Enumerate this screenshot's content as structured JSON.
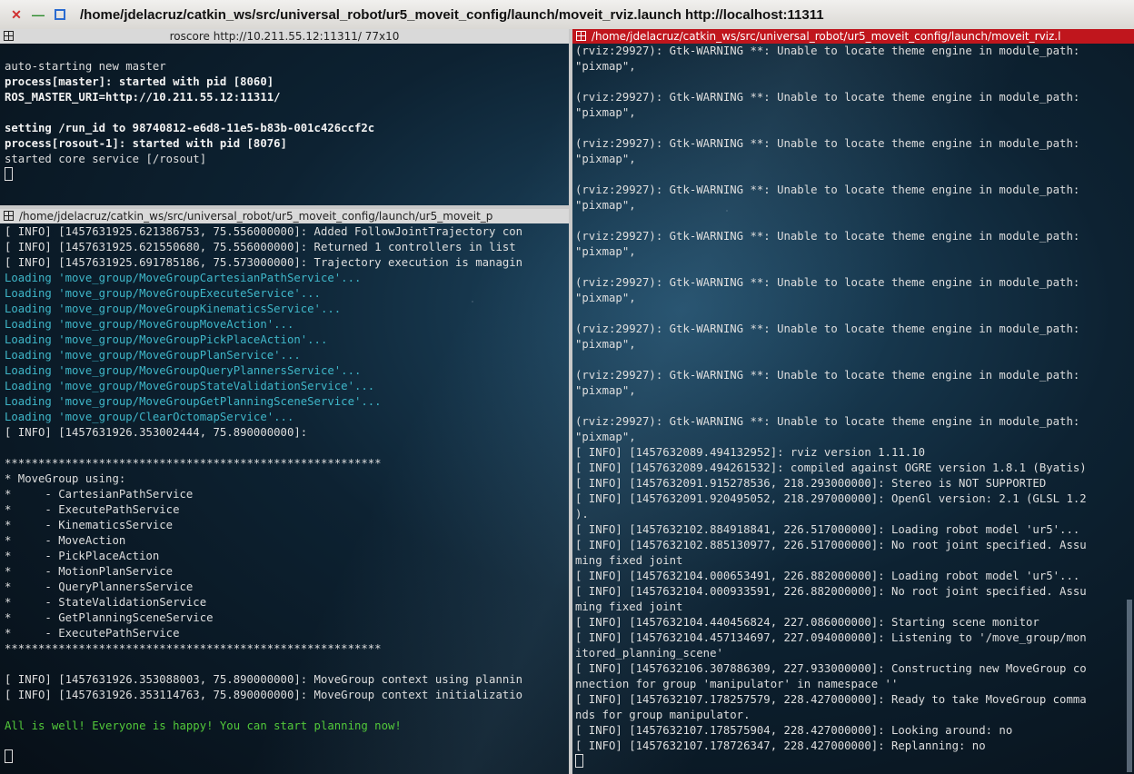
{
  "window": {
    "title": "/home/jdelacruz/catkin_ws/src/universal_robot/ur5_moveit_config/launch/moveit_rviz.launch http://localhost:11311"
  },
  "pane_roscore": {
    "title": "roscore http://10.211.55.12:11311/ 77x10",
    "lines": [
      {
        "t": "",
        "s": ""
      },
      {
        "t": "auto-starting new master",
        "s": ""
      },
      {
        "t": "process[master]: started with pid [8060]",
        "s": "b"
      },
      {
        "t": "ROS_MASTER_URI=http://10.211.55.12:11311/",
        "s": "b"
      },
      {
        "t": "",
        "s": ""
      },
      {
        "t": "setting /run_id to 98740812-e6d8-11e5-b83b-001c426ccf2c",
        "s": "b"
      },
      {
        "t": "process[rosout-1]: started with pid [8076]",
        "s": "b"
      },
      {
        "t": "started core service [/rosout]",
        "s": ""
      }
    ]
  },
  "pane_movegroup": {
    "title": "/home/jdelacruz/catkin_ws/src/universal_robot/ur5_moveit_config/launch/ur5_moveit_p",
    "lines": [
      {
        "t": "[ INFO] [1457631925.621386753, 75.556000000]: Added FollowJointTrajectory con",
        "s": ""
      },
      {
        "t": "[ INFO] [1457631925.621550680, 75.556000000]: Returned 1 controllers in list",
        "s": ""
      },
      {
        "t": "[ INFO] [1457631925.691785186, 75.573000000]: Trajectory execution is managin",
        "s": ""
      },
      {
        "t": "Loading 'move_group/MoveGroupCartesianPathService'...",
        "s": "c"
      },
      {
        "t": "Loading 'move_group/MoveGroupExecuteService'...",
        "s": "c"
      },
      {
        "t": "Loading 'move_group/MoveGroupKinematicsService'...",
        "s": "c"
      },
      {
        "t": "Loading 'move_group/MoveGroupMoveAction'...",
        "s": "c"
      },
      {
        "t": "Loading 'move_group/MoveGroupPickPlaceAction'...",
        "s": "c"
      },
      {
        "t": "Loading 'move_group/MoveGroupPlanService'...",
        "s": "c"
      },
      {
        "t": "Loading 'move_group/MoveGroupQueryPlannersService'...",
        "s": "c"
      },
      {
        "t": "Loading 'move_group/MoveGroupStateValidationService'...",
        "s": "c"
      },
      {
        "t": "Loading 'move_group/MoveGroupGetPlanningSceneService'...",
        "s": "c"
      },
      {
        "t": "Loading 'move_group/ClearOctomapService'...",
        "s": "c"
      },
      {
        "t": "[ INFO] [1457631926.353002444, 75.890000000]:",
        "s": ""
      },
      {
        "t": "",
        "s": ""
      },
      {
        "t": "********************************************************",
        "s": ""
      },
      {
        "t": "* MoveGroup using:",
        "s": ""
      },
      {
        "t": "*     - CartesianPathService",
        "s": ""
      },
      {
        "t": "*     - ExecutePathService",
        "s": ""
      },
      {
        "t": "*     - KinematicsService",
        "s": ""
      },
      {
        "t": "*     - MoveAction",
        "s": ""
      },
      {
        "t": "*     - PickPlaceAction",
        "s": ""
      },
      {
        "t": "*     - MotionPlanService",
        "s": ""
      },
      {
        "t": "*     - QueryPlannersService",
        "s": ""
      },
      {
        "t": "*     - StateValidationService",
        "s": ""
      },
      {
        "t": "*     - GetPlanningSceneService",
        "s": ""
      },
      {
        "t": "*     - ExecutePathService",
        "s": ""
      },
      {
        "t": "********************************************************",
        "s": ""
      },
      {
        "t": "",
        "s": ""
      },
      {
        "t": "[ INFO] [1457631926.353088003, 75.890000000]: MoveGroup context using plannin",
        "s": ""
      },
      {
        "t": "[ INFO] [1457631926.353114763, 75.890000000]: MoveGroup context initializatio",
        "s": ""
      },
      {
        "t": "",
        "s": ""
      },
      {
        "t": "All is well! Everyone is happy! You can start planning now!",
        "s": "g"
      }
    ]
  },
  "pane_rviz": {
    "title": "/home/jdelacruz/catkin_ws/src/universal_robot/ur5_moveit_config/launch/moveit_rviz.l",
    "lines": [
      {
        "t": "(rviz:29927): Gtk-WARNING **: Unable to locate theme engine in module_path:",
        "s": ""
      },
      {
        "t": "\"pixmap\",",
        "s": ""
      },
      {
        "t": "",
        "s": ""
      },
      {
        "t": "(rviz:29927): Gtk-WARNING **: Unable to locate theme engine in module_path:",
        "s": ""
      },
      {
        "t": "\"pixmap\",",
        "s": ""
      },
      {
        "t": "",
        "s": ""
      },
      {
        "t": "(rviz:29927): Gtk-WARNING **: Unable to locate theme engine in module_path:",
        "s": ""
      },
      {
        "t": "\"pixmap\",",
        "s": ""
      },
      {
        "t": "",
        "s": ""
      },
      {
        "t": "(rviz:29927): Gtk-WARNING **: Unable to locate theme engine in module_path:",
        "s": ""
      },
      {
        "t": "\"pixmap\",",
        "s": ""
      },
      {
        "t": "",
        "s": ""
      },
      {
        "t": "(rviz:29927): Gtk-WARNING **: Unable to locate theme engine in module_path:",
        "s": ""
      },
      {
        "t": "\"pixmap\",",
        "s": ""
      },
      {
        "t": "",
        "s": ""
      },
      {
        "t": "(rviz:29927): Gtk-WARNING **: Unable to locate theme engine in module_path:",
        "s": ""
      },
      {
        "t": "\"pixmap\",",
        "s": ""
      },
      {
        "t": "",
        "s": ""
      },
      {
        "t": "(rviz:29927): Gtk-WARNING **: Unable to locate theme engine in module_path:",
        "s": ""
      },
      {
        "t": "\"pixmap\",",
        "s": ""
      },
      {
        "t": "",
        "s": ""
      },
      {
        "t": "(rviz:29927): Gtk-WARNING **: Unable to locate theme engine in module_path:",
        "s": ""
      },
      {
        "t": "\"pixmap\",",
        "s": ""
      },
      {
        "t": "",
        "s": ""
      },
      {
        "t": "(rviz:29927): Gtk-WARNING **: Unable to locate theme engine in module_path:",
        "s": ""
      },
      {
        "t": "\"pixmap\",",
        "s": ""
      },
      {
        "t": "[ INFO] [1457632089.494132952]: rviz version 1.11.10",
        "s": ""
      },
      {
        "t": "[ INFO] [1457632089.494261532]: compiled against OGRE version 1.8.1 (Byatis)",
        "s": ""
      },
      {
        "t": "[ INFO] [1457632091.915278536, 218.293000000]: Stereo is NOT SUPPORTED",
        "s": ""
      },
      {
        "t": "[ INFO] [1457632091.920495052, 218.297000000]: OpenGl version: 2.1 (GLSL 1.2",
        "s": ""
      },
      {
        "t": ").",
        "s": ""
      },
      {
        "t": "[ INFO] [1457632102.884918841, 226.517000000]: Loading robot model 'ur5'...",
        "s": ""
      },
      {
        "t": "[ INFO] [1457632102.885130977, 226.517000000]: No root joint specified. Assu",
        "s": ""
      },
      {
        "t": "ming fixed joint",
        "s": ""
      },
      {
        "t": "[ INFO] [1457632104.000653491, 226.882000000]: Loading robot model 'ur5'...",
        "s": ""
      },
      {
        "t": "[ INFO] [1457632104.000933591, 226.882000000]: No root joint specified. Assu",
        "s": ""
      },
      {
        "t": "ming fixed joint",
        "s": ""
      },
      {
        "t": "[ INFO] [1457632104.440456824, 227.086000000]: Starting scene monitor",
        "s": ""
      },
      {
        "t": "[ INFO] [1457632104.457134697, 227.094000000]: Listening to '/move_group/mon",
        "s": ""
      },
      {
        "t": "itored_planning_scene'",
        "s": ""
      },
      {
        "t": "[ INFO] [1457632106.307886309, 227.933000000]: Constructing new MoveGroup co",
        "s": ""
      },
      {
        "t": "nnection for group 'manipulator' in namespace ''",
        "s": ""
      },
      {
        "t": "[ INFO] [1457632107.178257579, 228.427000000]: Ready to take MoveGroup comma",
        "s": ""
      },
      {
        "t": "nds for group manipulator.",
        "s": ""
      },
      {
        "t": "[ INFO] [1457632107.178575904, 228.427000000]: Looking around: no",
        "s": ""
      },
      {
        "t": "[ INFO] [1457632107.178726347, 228.427000000]: Replanning: no",
        "s": ""
      }
    ]
  }
}
